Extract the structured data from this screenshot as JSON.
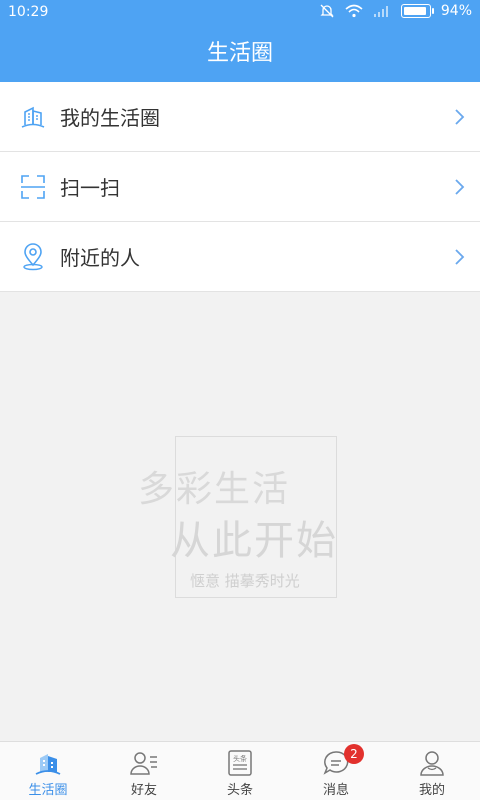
{
  "status_bar": {
    "time": "10:29",
    "battery": "94%",
    "battery_level": 0.94
  },
  "header": {
    "title": "生活圈"
  },
  "menu": [
    {
      "label": "我的生活圈",
      "icon": "building-icon"
    },
    {
      "label": "扫一扫",
      "icon": "scan-icon"
    },
    {
      "label": "附近的人",
      "icon": "location-pin-icon"
    }
  ],
  "watermark": {
    "line1": "多彩生活",
    "line2": "从此开始",
    "line3": "惬意 描摹秀时光"
  },
  "tabs": [
    {
      "label": "生活圈",
      "icon": "building-icon",
      "active": true
    },
    {
      "label": "好友",
      "icon": "contacts-icon"
    },
    {
      "label": "头条",
      "icon": "news-icon",
      "icon_text": "头条"
    },
    {
      "label": "消息",
      "icon": "chat-icon",
      "badge": "2"
    },
    {
      "label": "我的",
      "icon": "user-icon"
    }
  ],
  "colors": {
    "primary": "#4ea3f3",
    "active_tab": "#3b8fe8",
    "badge": "#e2312d",
    "chevron": "#6aa8ee"
  }
}
